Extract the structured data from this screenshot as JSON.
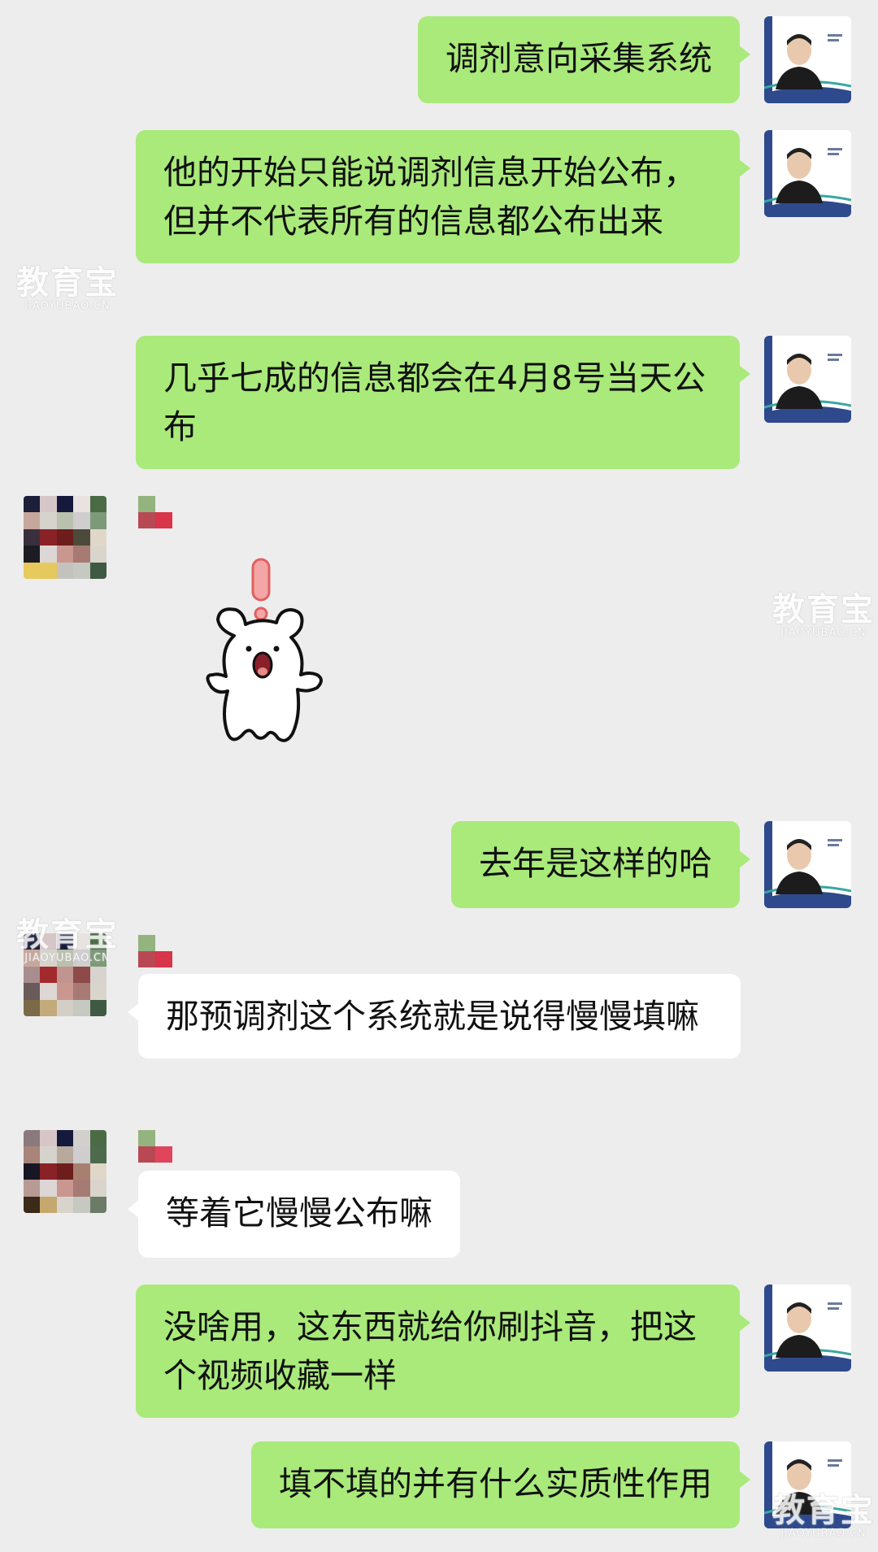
{
  "messages": [
    {
      "side": "me",
      "text": "调剂意向采集系统"
    },
    {
      "side": "me",
      "text": "他的开始只能说调剂信息开始公布，但并不代表所有的信息都公布出来"
    },
    {
      "side": "me",
      "text": "几乎七成的信息都会在4月8号当天公布"
    },
    {
      "side": "other",
      "sticker": "surprised-bear-sticker"
    },
    {
      "side": "me",
      "text": "去年是这样的哈"
    },
    {
      "side": "other",
      "text": "那预调剂这个系统就是说得慢慢填嘛"
    },
    {
      "side": "other",
      "text": "等着它慢慢公布嘛"
    },
    {
      "side": "me",
      "text": "没啥用，这东西就给你刷抖音，把这个视频收藏一样"
    },
    {
      "side": "me",
      "text": "填不填的并有什么实质性作用"
    }
  ],
  "watermark": {
    "cn": "教育宝",
    "en": "JIAOYUBAO.CN"
  },
  "colors": {
    "background": "#ededed",
    "my_bubble": "#a9ea7a",
    "other_bubble": "#ffffff",
    "avatar_band": "#2e4a8c"
  }
}
